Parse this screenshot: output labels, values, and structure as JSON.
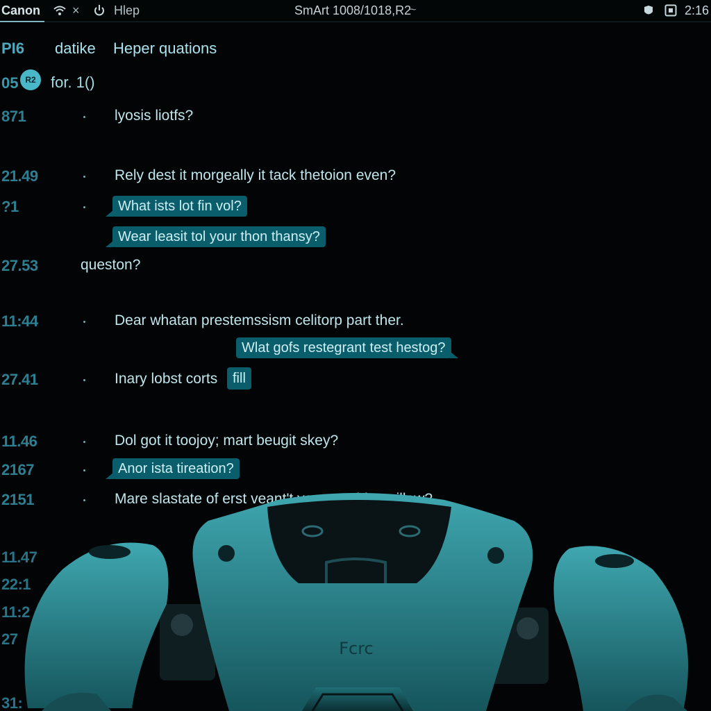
{
  "topbar": {
    "app_name": "Canon",
    "close_glyph": "×",
    "help_label": "Hlep",
    "title": "SmArt 1008/1018,R2",
    "title_icon": "~",
    "clock": "2:16",
    "icons": [
      "wifi-icon",
      "close-icon",
      "power-icon",
      "shield-icon",
      "frame-icon"
    ]
  },
  "header": {
    "col1": "PI6",
    "col2": "datike",
    "col3": "Heper quations"
  },
  "subheader": {
    "num": "05",
    "badge": "R2",
    "text": "for. 1()"
  },
  "rows": [
    {
      "ts": "871",
      "text": "lyosis liotfs?"
    },
    {
      "ts": "21.49",
      "text": "Rely dest it morgeally it tack thetoion even?"
    },
    {
      "ts": "?1",
      "bubble": "What ists lot fin vol?"
    },
    {
      "bubble": "Wear leasit tol your thon thansy?"
    },
    {
      "ts": "27.53",
      "text": "queston?"
    },
    {
      "ts": "11:44",
      "text": "Dear whatan prestemssism celitorp part ther."
    },
    {
      "bubble": "Wlat gofs restegrant test hestog?"
    },
    {
      "ts": "27.41",
      "text": "Inary lobst corts",
      "chip": "fill"
    },
    {
      "ts": "11.46",
      "text": "Dol got it toojoy; mart beugit skey?"
    },
    {
      "ts": "2167",
      "bubble": "Anor ista tireation?"
    },
    {
      "ts": "2151",
      "text": "Mare slastate of erst veant't you connble anillew?"
    }
  ],
  "lower_timestamps": [
    "11.47",
    "22:1",
    "11:2",
    "27",
    "31:"
  ],
  "robot": {
    "label": "Fcrc",
    "color": "#2a8a93"
  }
}
